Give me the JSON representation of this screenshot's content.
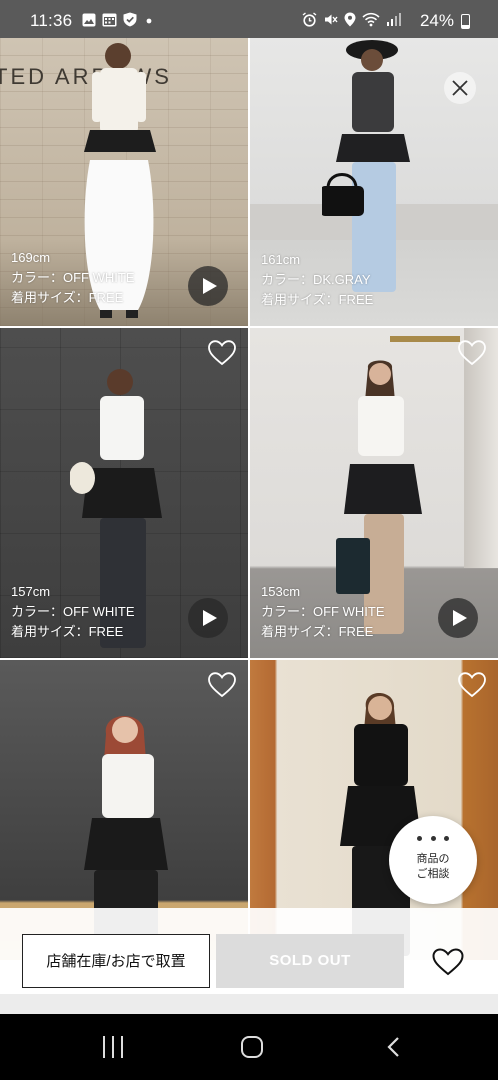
{
  "status_bar": {
    "time": "11:36",
    "battery": "24%",
    "left_icons": [
      "gallery-icon",
      "calendar-icon",
      "shield-icon",
      "dot-icon"
    ],
    "right_icons": [
      "alarm-icon",
      "mute-icon",
      "location-icon",
      "wifi-icon",
      "signal-icon",
      "battery-icon"
    ]
  },
  "tiles": [
    {
      "height": "169cm",
      "color": "カラー：OFF WHITE",
      "size": "着用サイズ：FREE",
      "wall_text": "TED ARROWS"
    },
    {
      "height": "161cm",
      "color": "カラー：DK.GRAY",
      "size": "着用サイズ：FREE"
    },
    {
      "height": "157cm",
      "color": "カラー：OFF WHITE",
      "size": "着用サイズ：FREE"
    },
    {
      "height": "153cm",
      "color": "カラー：OFF WHITE",
      "size": "着用サイズ：FREE"
    }
  ],
  "consult": {
    "line1": "商品の",
    "line2": "ご相談"
  },
  "actions": {
    "store_label": "店舗在庫/お店で取置",
    "soldout_label": "SOLD OUT"
  },
  "colors": {
    "status_bar_bg": "#5a5a5a",
    "soldout_bg": "#dcdcdc",
    "nav_bg": "#000000"
  }
}
